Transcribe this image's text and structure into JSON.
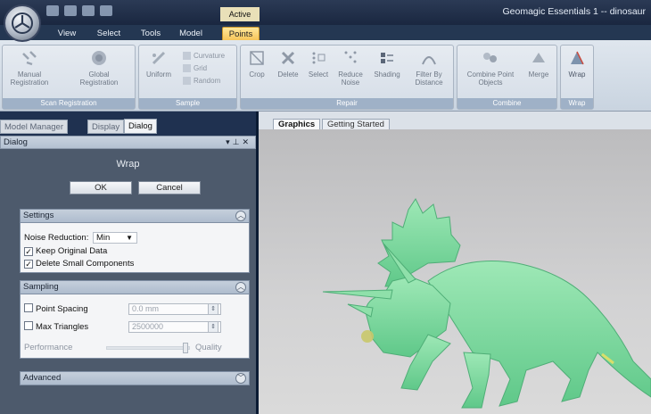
{
  "app": {
    "window_title": "Geomagic Essentials 1 -- dinosaur",
    "active_context": "Active"
  },
  "ribbon": {
    "tabs": [
      "View",
      "Select",
      "Tools",
      "Model",
      "Points"
    ],
    "active_tab": "Points",
    "groups": {
      "scan_registration": {
        "label": "Scan Registration",
        "manual": "Manual Registration",
        "global": "Global Registration"
      },
      "sample": {
        "label": "Sample",
        "uniform": "Uniform",
        "curvature": "Curvature",
        "grid": "Grid",
        "random": "Random"
      },
      "repair": {
        "label": "Repair",
        "crop": "Crop",
        "delete": "Delete",
        "select": "Select",
        "reduce_noise": "Reduce Noise",
        "shading": "Shading",
        "filter_by_distance": "Filter By Distance"
      },
      "combine": {
        "label": "Combine",
        "combine_point_objects": "Combine Point Objects",
        "merge": "Merge"
      },
      "wrap": {
        "label": "Wrap",
        "wrap": "Wrap"
      }
    }
  },
  "panel": {
    "tabs": [
      "Model Manager",
      "Display",
      "Dialog"
    ],
    "active_tab": "Dialog",
    "header": "Dialog",
    "dialog_title": "Wrap",
    "ok_label": "OK",
    "cancel_label": "Cancel",
    "settings": {
      "title": "Settings",
      "noise_label": "Noise Reduction:",
      "noise_value": "Min",
      "keep_original": "Keep Original Data",
      "keep_original_checked": true,
      "delete_small": "Delete Small Components",
      "delete_small_checked": true
    },
    "sampling": {
      "title": "Sampling",
      "point_spacing_label": "Point Spacing",
      "point_spacing_value": "0.0 mm",
      "max_triangles_label": "Max Triangles",
      "max_triangles_value": "2500000",
      "performance_label": "Performance",
      "quality_label": "Quality",
      "slider_level": 0.95
    },
    "advanced": {
      "title": "Advanced"
    }
  },
  "viewport": {
    "tabs": [
      "Graphics",
      "Getting Started"
    ],
    "active_tab": "Graphics"
  },
  "colors": {
    "model": "#7fdba0",
    "active_tab": "#f6c55a",
    "title_bar": "#1a2740"
  }
}
